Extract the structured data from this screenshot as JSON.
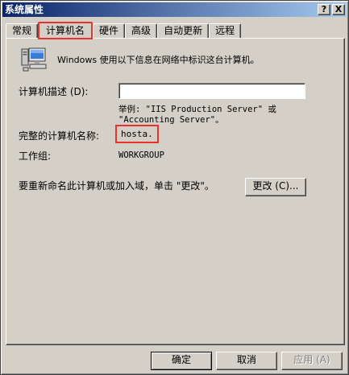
{
  "window": {
    "title": "系统属性",
    "help_label": "?",
    "close_label": "X"
  },
  "tabs": [
    {
      "label": "常规"
    },
    {
      "label": "计算机名"
    },
    {
      "label": "硬件"
    },
    {
      "label": "高级"
    },
    {
      "label": "自动更新"
    },
    {
      "label": "远程"
    }
  ],
  "panel": {
    "intro_text": "Windows 使用以下信息在网络中标识这台计算机。",
    "description_label": "计算机描述 (D):",
    "description_value": "",
    "example_text": "举例: \"IIS Production Server\" 或\n\"Accounting Server\"。",
    "full_name_label": "完整的计算机名称:",
    "full_name_value": "hosta.",
    "workgroup_label": "工作组:",
    "workgroup_value": "WORKGROUP",
    "rename_text": "要重新命名此计算机或加入域，单击 \"更改\"。",
    "change_button": "更改 (C)..."
  },
  "buttons": {
    "ok": "确定",
    "cancel": "取消",
    "apply": "应用 (A)"
  }
}
